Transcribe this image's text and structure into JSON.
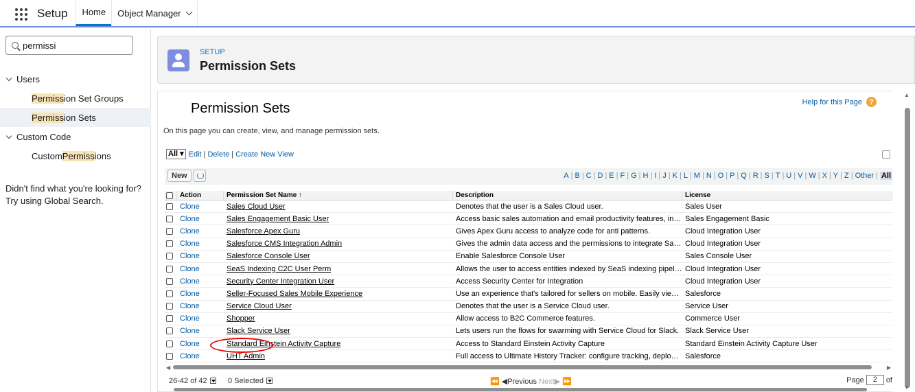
{
  "topbar": {
    "app_name": "Setup",
    "tabs": [
      {
        "label": "Home"
      },
      {
        "label": "Object Manager"
      }
    ]
  },
  "sidebar": {
    "search_value": "permissi",
    "groups": [
      {
        "label": "Users",
        "items": [
          {
            "hl": "Permiss",
            "rest": "ion Set Groups"
          },
          {
            "hl": "Permiss",
            "rest": "ion Sets"
          }
        ]
      },
      {
        "label": "Custom Code",
        "items": [
          {
            "pre": "Custom ",
            "hl": "Permiss",
            "rest": "ions"
          }
        ]
      }
    ],
    "help_text": "Didn't find what you're looking for? Try using Global Search."
  },
  "header": {
    "eyebrow": "SETUP",
    "title": "Permission Sets"
  },
  "page": {
    "title": "Permission Sets",
    "help_link": "Help for this Page",
    "help_icon": "?",
    "intro": "On this page you can create, view, and manage permission sets.",
    "view_selected": "All",
    "view_links": [
      "Edit",
      "Delete",
      "Create New View"
    ],
    "new_button": "New",
    "alpha": [
      "A",
      "B",
      "C",
      "D",
      "E",
      "F",
      "G",
      "H",
      "I",
      "J",
      "K",
      "L",
      "M",
      "N",
      "O",
      "P",
      "Q",
      "R",
      "S",
      "T",
      "U",
      "V",
      "W",
      "X",
      "Y",
      "Z",
      "Other",
      "All"
    ]
  },
  "table": {
    "columns": [
      "Action",
      "Permission Set Name ↑",
      "Description",
      "License"
    ],
    "action_label": "Clone",
    "rows": [
      {
        "name": "Sales Cloud User",
        "desc": "Denotes that the user is a Sales Cloud user.",
        "license": "Sales User"
      },
      {
        "name": "Sales Engagement Basic User",
        "desc": "Access basic sales automation and email productivity features, includin...",
        "license": "Sales Engagement Basic"
      },
      {
        "name": "Salesforce Apex Guru",
        "desc": "Gives Apex Guru access to analyze code for anti patterns.",
        "license": "Cloud Integration User"
      },
      {
        "name": "Salesforce CMS Integration Admin",
        "desc": "Gives the admin data access and the permissions to integrate Salesfor...",
        "license": "Cloud Integration User"
      },
      {
        "name": "Salesforce Console User",
        "desc": "Enable Salesforce Console User",
        "license": "Sales Console User"
      },
      {
        "name": "SeaS Indexing C2C User Perm",
        "desc": "Allows the user to access entities indexed by SeaS indexing pipeline.",
        "license": "Cloud Integration User"
      },
      {
        "name": "Security Center Integration User",
        "desc": "Access Security Center for Integration",
        "license": "Cloud Integration User"
      },
      {
        "name": "Seller-Focused Sales Mobile Experience",
        "desc": "Use an experience that's tailored for sellers on mobile. Easily view and ...",
        "license": "Salesforce"
      },
      {
        "name": "Service Cloud User",
        "desc": "Denotes that the user is a Service Cloud user.",
        "license": "Service User"
      },
      {
        "name": "Shopper",
        "desc": "Allow access to B2C Commerce features.",
        "license": "Commerce User"
      },
      {
        "name": "Slack Service User",
        "desc": "Lets users run the flows for swarming with Service Cloud for Slack.",
        "license": "Slack Service User"
      },
      {
        "name": "Standard Einstein Activity Capture",
        "desc": "Access to Standard Einstein Activity Capture",
        "license": "Standard Einstein Activity Capture User"
      },
      {
        "name": "UHT Admin",
        "desc": "Full access to Ultimate History Tracker: configure tracking, deploy trigg...",
        "license": "Salesforce"
      }
    ]
  },
  "pager": {
    "range": "26-42 of 42",
    "selected": "0 Selected",
    "first": "⏪",
    "prev": "◀Previous",
    "next": "Next▶",
    "last": "⏩",
    "page_label": "Page",
    "page_value": "2",
    "of_label": "of"
  }
}
